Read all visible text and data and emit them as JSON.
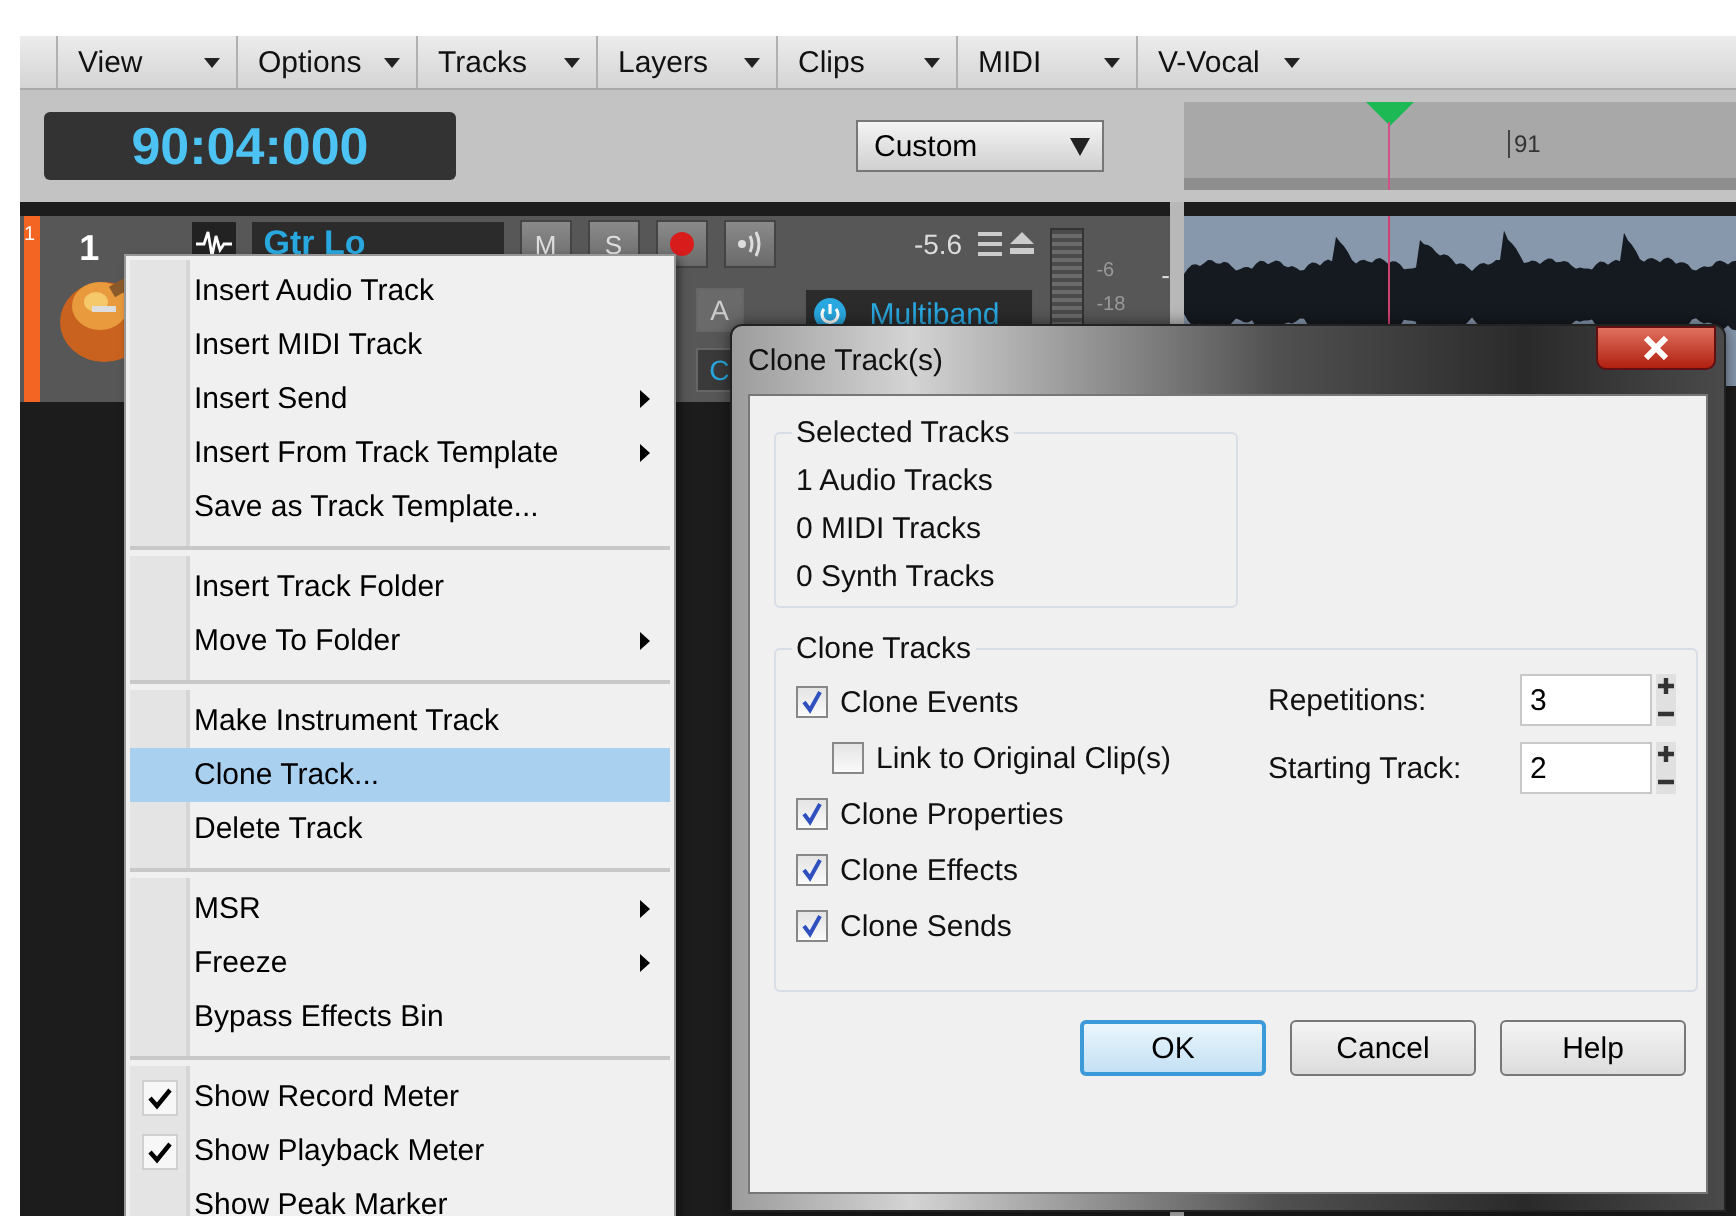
{
  "menu_bar": [
    "View",
    "Options",
    "Tracks",
    "Layers",
    "Clips",
    "MIDI",
    "V-Vocal"
  ],
  "transport": {
    "time": "90:04:000",
    "preset": "Custom"
  },
  "ruler": {
    "bar_label": "91"
  },
  "track": {
    "color_number": "1",
    "number": "1",
    "name": "Gtr Lo",
    "mute": "M",
    "solo": "S",
    "side_buttons": [
      "A",
      "C"
    ],
    "volume": "-5.6",
    "fx": "Multiband",
    "meter_ticks": [
      "-6",
      "-18"
    ],
    "clip_label": "-"
  },
  "context_menu": {
    "groups": [
      {
        "items": [
          {
            "label": "Insert Audio Track",
            "submenu": false,
            "checked": false,
            "selected": false
          },
          {
            "label": "Insert MIDI Track",
            "submenu": false,
            "checked": false,
            "selected": false
          },
          {
            "label": "Insert Send",
            "submenu": true,
            "checked": false,
            "selected": false
          },
          {
            "label": "Insert From Track Template",
            "submenu": true,
            "checked": false,
            "selected": false
          },
          {
            "label": "Save as Track Template...",
            "submenu": false,
            "checked": false,
            "selected": false
          }
        ]
      },
      {
        "items": [
          {
            "label": "Insert Track Folder",
            "submenu": false,
            "checked": false,
            "selected": false
          },
          {
            "label": "Move To Folder",
            "submenu": true,
            "checked": false,
            "selected": false
          }
        ]
      },
      {
        "items": [
          {
            "label": "Make Instrument Track",
            "submenu": false,
            "checked": false,
            "selected": false
          },
          {
            "label": "Clone Track...",
            "submenu": false,
            "checked": false,
            "selected": true
          },
          {
            "label": "Delete Track",
            "submenu": false,
            "checked": false,
            "selected": false
          }
        ]
      },
      {
        "items": [
          {
            "label": "MSR",
            "submenu": true,
            "checked": false,
            "selected": false
          },
          {
            "label": "Freeze",
            "submenu": true,
            "checked": false,
            "selected": false
          },
          {
            "label": "Bypass Effects Bin",
            "submenu": false,
            "checked": false,
            "selected": false
          }
        ]
      },
      {
        "items": [
          {
            "label": "Show Record Meter",
            "submenu": false,
            "checked": true,
            "selected": false
          },
          {
            "label": "Show Playback Meter",
            "submenu": false,
            "checked": true,
            "selected": false
          },
          {
            "label": "Show Peak Marker",
            "submenu": false,
            "checked": false,
            "selected": false
          }
        ]
      }
    ]
  },
  "dialog": {
    "title": "Clone Track(s)",
    "selected_tracks": {
      "title": "Selected Tracks",
      "lines": [
        "1 Audio Tracks",
        "0 MIDI Tracks",
        "0 Synth Tracks"
      ]
    },
    "clone_tracks": {
      "title": "Clone Tracks",
      "options": [
        {
          "label": "Clone Events",
          "checked": true,
          "children": [
            {
              "label": "Link to Original Clip(s)",
              "checked": false
            }
          ]
        },
        {
          "label": "Clone Properties",
          "checked": true
        },
        {
          "label": "Clone Effects",
          "checked": true
        },
        {
          "label": "Clone Sends",
          "checked": true
        }
      ],
      "fields": [
        {
          "label": "Repetitions:",
          "value": "3"
        },
        {
          "label": "Starting Track:",
          "value": "2"
        }
      ]
    },
    "buttons": [
      {
        "label": "OK",
        "default": true
      },
      {
        "label": "Cancel",
        "default": false
      },
      {
        "label": "Help",
        "default": false
      }
    ]
  }
}
